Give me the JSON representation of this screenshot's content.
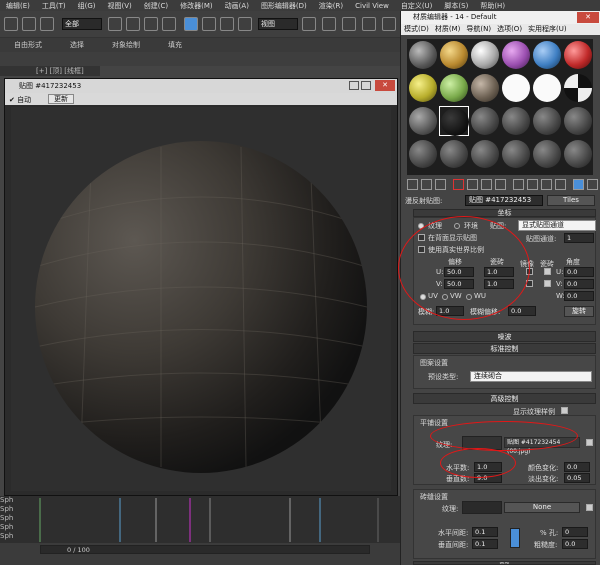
{
  "menubar": [
    "编辑(E)",
    "工具(T)",
    "组(G)",
    "视图(V)",
    "创建(C)",
    "修改器(M)",
    "动画(A)",
    "图形编辑器(D)",
    "渲染(R)",
    "Civil View",
    "自定义(U)",
    "脚本(S)",
    "帮助(H)"
  ],
  "toolbar": {
    "selection_filter": "全部",
    "view_ref": "视图"
  },
  "ribbon": [
    "自由形式",
    "选择",
    "对象绘制",
    "填充"
  ],
  "viewport_label": "[+] [顶] [线框]",
  "render_window": {
    "title": "贴图 #417232453",
    "auto_label": "自动",
    "update_button": "更新"
  },
  "timeline": {
    "frame_text": "0 / 100",
    "track_labels": [
      "Sph",
      "Sph",
      "Sph",
      "Sph",
      "Sph"
    ]
  },
  "material_editor": {
    "title": "材质编辑器 - 14 - Default",
    "menu": [
      "模式(D)",
      "材质(M)",
      "导航(N)",
      "选项(O)",
      "实用程序(U)"
    ],
    "map_label": "漫反射贴图:",
    "map_name": "贴图 #417232453",
    "map_type": "Tiles",
    "coords_title": "坐标",
    "texture_label": "纹理",
    "env_label": "环境",
    "mapping_label": "贴图:",
    "mapping_value": "显式贴图通道",
    "show_map_label": "在背面显示贴图",
    "realworld_label": "使用真实世界比例",
    "channel_label": "贴图通道:",
    "channel_value": "1",
    "offset_label": "偏移",
    "tiling_label": "瓷砖",
    "mirror_label": "镜像",
    "tile_label": "瓷砖",
    "angle_label": "角度",
    "u_offset": "50.0",
    "v_offset": "50.0",
    "u_tiling": "1.0",
    "v_tiling": "1.0",
    "u_angle": "0.0",
    "v_angle": "0.0",
    "w_angle": "0.0",
    "uv_label": "UV",
    "vw_label": "VW",
    "wu_label": "WU",
    "blur_label": "模糊:",
    "blur_value": "1.0",
    "blur_offset_label": "模糊偏移:",
    "blur_offset_value": "0.0",
    "rotate_button": "旋转",
    "noise_rollout": "噪波",
    "std_rollout": "标准控制",
    "pattern_group": "图案设置",
    "preset_label": "预设类型:",
    "preset_value": "连续砌合",
    "adv_rollout": "高级控制",
    "show_texture_label": "显示纹理样例",
    "tile_setup_group": "平铺设置",
    "texture_field_label": "纹理:",
    "texture_map_name": "贴图 #417232454 (00.jpg)",
    "h_count_label": "水平数:",
    "h_count": "1.0",
    "v_count_label": "垂直数:",
    "v_count": "9.0",
    "color_var_label": "颜色变化:",
    "color_var": "0.0",
    "fade_var_label": "淡出变化:",
    "fade_var": "0.05",
    "grout_group": "砖缝设置",
    "grout_texture_label": "纹理:",
    "none_label": "None",
    "h_gap_label": "水平间距:",
    "h_gap": "0.1",
    "v_gap_label": "垂直间距:",
    "v_gap": "0.1",
    "holes_label": "% 孔:",
    "holes": "0",
    "rough_label": "粗糙度:",
    "rough": "0.0",
    "misc_rollout": "杂项"
  }
}
